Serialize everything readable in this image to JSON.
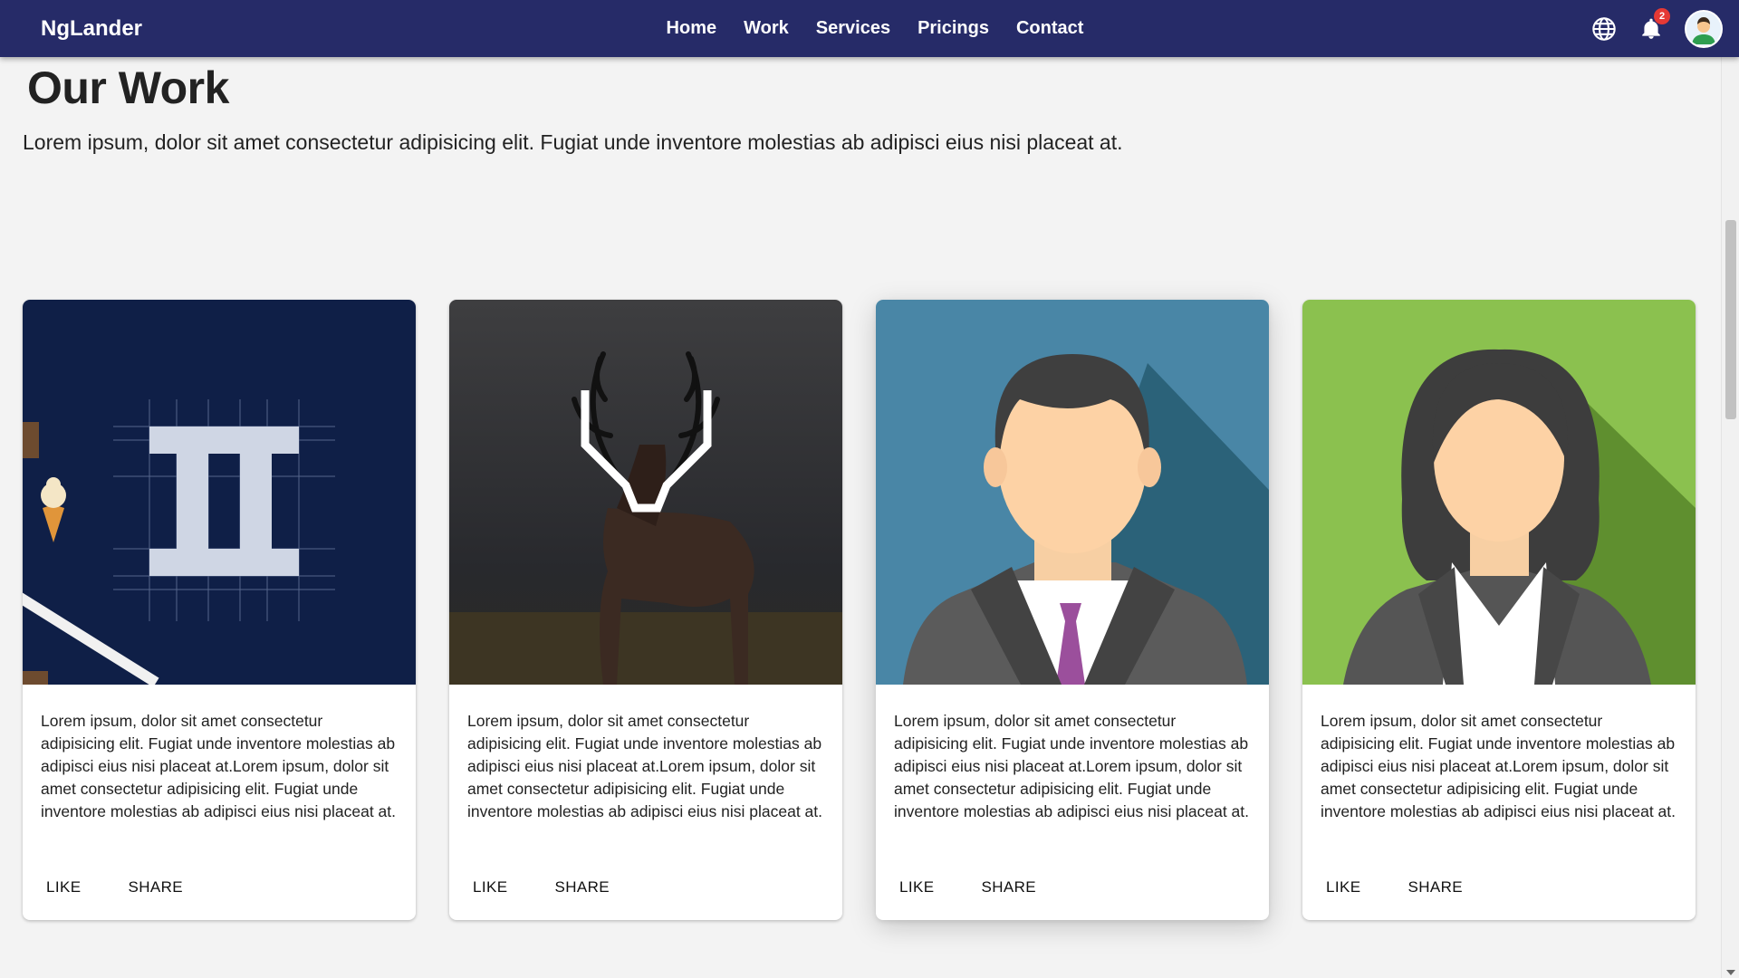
{
  "header": {
    "brand": "NgLander",
    "nav": [
      "Home",
      "Work",
      "Services",
      "Pricings",
      "Contact"
    ],
    "icons": [
      "globe-icon",
      "bell-icon",
      "avatar"
    ],
    "notification_count": "2",
    "background": "#262b68"
  },
  "main": {
    "title": "Our Work",
    "description": "Lorem ipsum, dolor sit amet consectetur adipisicing elit. Fugiat unde inventore molestias ab adipisci eius nisi placeat at."
  },
  "cards": [
    {
      "image": "typography-logo",
      "text": "Lorem ipsum, dolor sit amet consectetur adipisicing elit. Fugiat unde inventore molestias ab adipisci eius nisi placeat at.Lorem ipsum, dolor sit amet consectetur adipisicing elit. Fugiat unde inventore molestias ab adipisci eius nisi placeat at.",
      "like": "LIKE",
      "share": "SHARE"
    },
    {
      "image": "deer-logo",
      "text": "Lorem ipsum, dolor sit amet consectetur adipisicing elit. Fugiat unde inventore molestias ab adipisci eius nisi placeat at.Lorem ipsum, dolor sit amet consectetur adipisicing elit. Fugiat unde inventore molestias ab adipisci eius nisi placeat at.",
      "like": "LIKE",
      "share": "SHARE"
    },
    {
      "image": "businessman-avatar",
      "text": "Lorem ipsum, dolor sit amet consectetur adipisicing elit. Fugiat unde inventore molestias ab adipisci eius nisi placeat at.Lorem ipsum, dolor sit amet consectetur adipisicing elit. Fugiat unde inventore molestias ab adipisci eius nisi placeat at.",
      "like": "LIKE",
      "share": "SHARE"
    },
    {
      "image": "businesswoman-avatar",
      "text": "Lorem ipsum, dolor sit amet consectetur adipisicing elit. Fugiat unde inventore molestias ab adipisci eius nisi placeat at.Lorem ipsum, dolor sit amet consectetur adipisicing elit. Fugiat unde inventore molestias ab adipisci eius nisi placeat at.",
      "like": "LIKE",
      "share": "SHARE"
    }
  ]
}
